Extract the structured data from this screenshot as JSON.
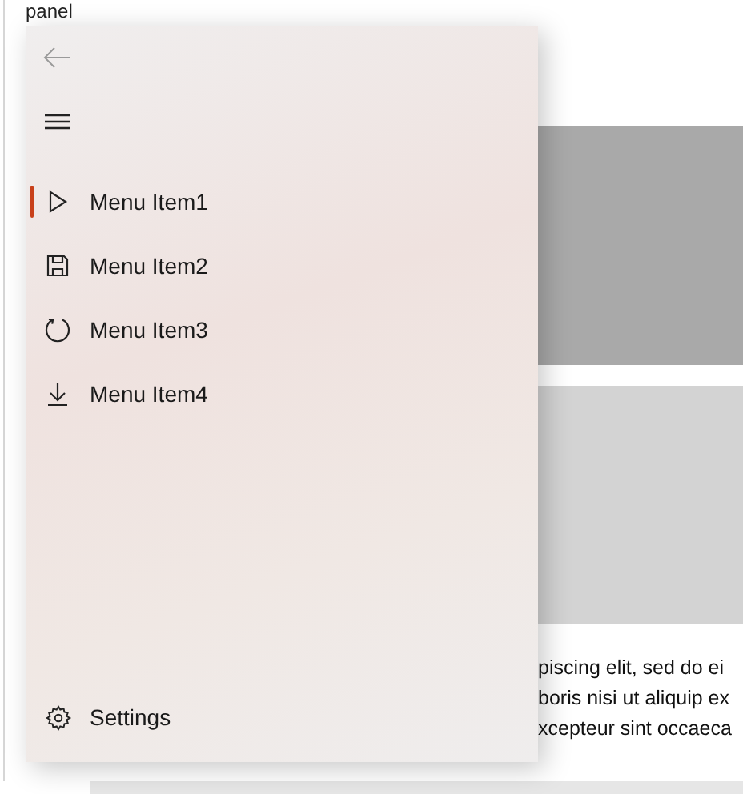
{
  "page": {
    "heading": "panel",
    "paragraph_lines": [
      "piscing elit, sed do ei",
      "boris nisi ut aliquip ex",
      "xcepteur sint occaeca"
    ]
  },
  "nav": {
    "items": [
      {
        "label": "Menu Item1",
        "kind": "play",
        "selected": true
      },
      {
        "label": "Menu Item2",
        "kind": "save",
        "selected": false
      },
      {
        "label": "Menu Item3",
        "kind": "refresh",
        "selected": false
      },
      {
        "label": "Menu Item4",
        "kind": "download",
        "selected": false
      }
    ],
    "settings": {
      "label": "Settings"
    }
  }
}
